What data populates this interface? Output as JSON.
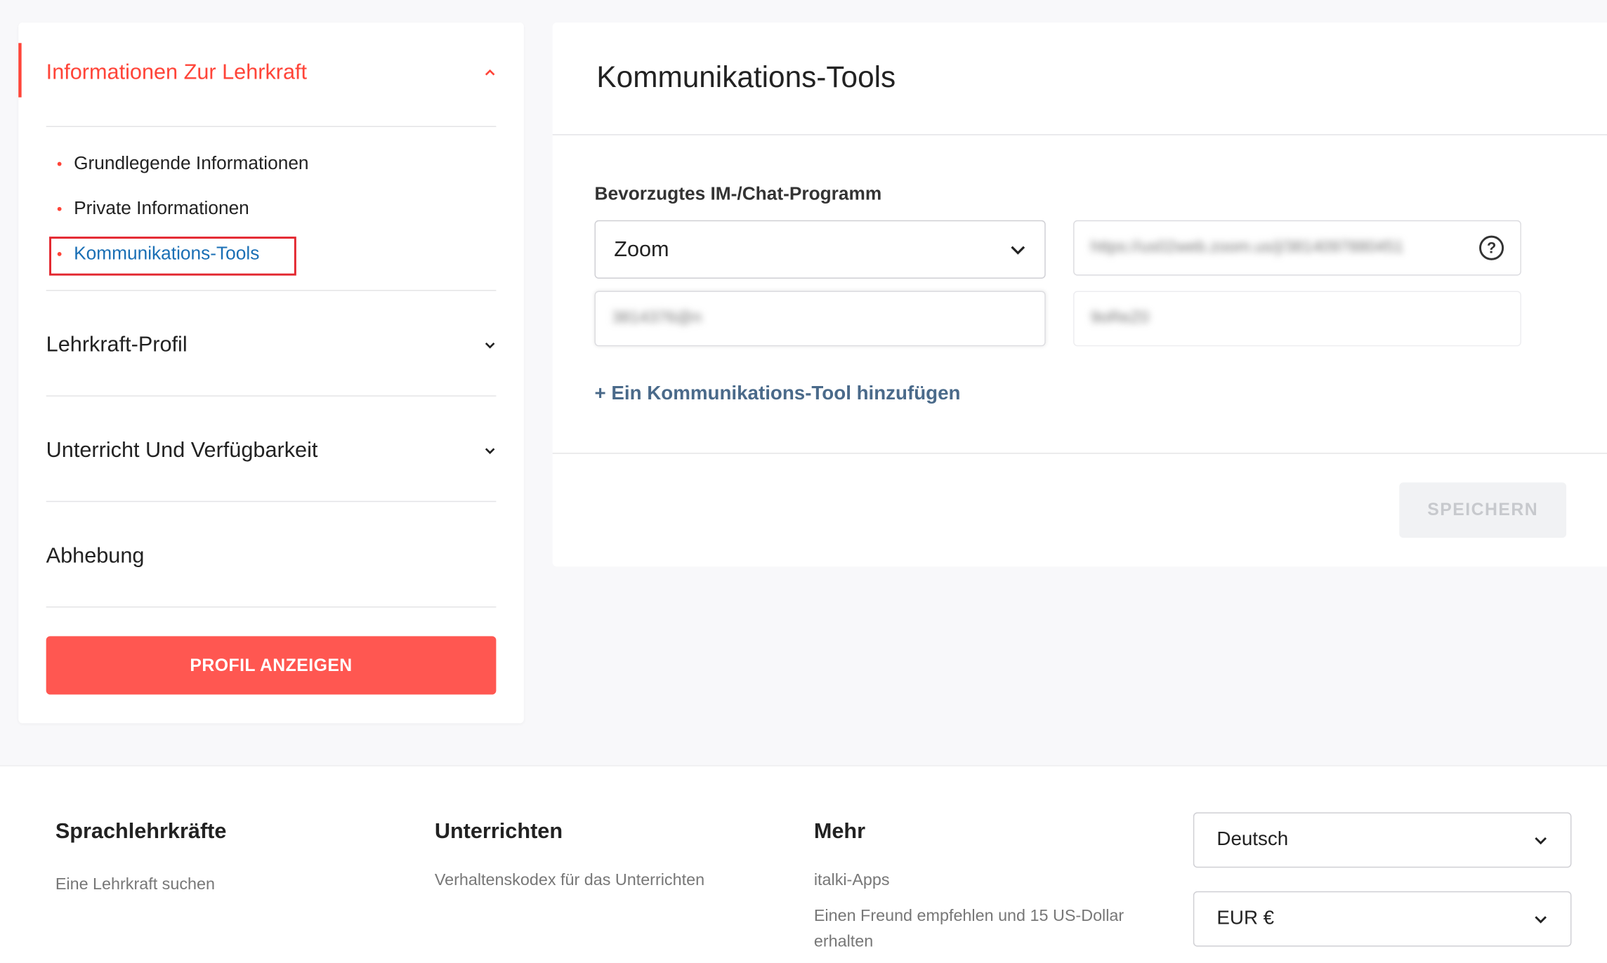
{
  "sidebar": {
    "section_teacher_info": "Informationen Zur Lehrkraft",
    "sub_items": [
      "Grundlegende Informationen",
      "Private Informationen",
      "Kommunikations-Tools"
    ],
    "section_profile": "Lehrkraft-Profil",
    "section_teaching": "Unterricht Und Verfügbarkeit",
    "section_withdrawal": "Abhebung",
    "profile_button": "PROFIL ANZEIGEN"
  },
  "main": {
    "title": "Kommunikations-Tools",
    "field_label": "Bevorzugtes IM-/Chat-Programm",
    "program_selected": "Zoom",
    "meeting_link_blurred": "https://us02web.zoom.us/j/3814097880451",
    "meeting_id_blurred": "3814376@n",
    "passcode_blurred": "9oReZ0",
    "help_symbol": "?",
    "add_tool_link": "+ Ein Kommunikations-Tool hinzufügen",
    "save_button": "SPEICHERN"
  },
  "footer": {
    "col1_title": "Sprachlehrkräfte",
    "col1_link1": "Eine Lehrkraft suchen",
    "col2_title": "Unterrichten",
    "col2_link1": "Verhaltenskodex für das Unterrichten",
    "col3_title": "Mehr",
    "col3_link1": "italki-Apps",
    "col3_link2": "Einen Freund empfehlen und 15 US-Dollar erhalten",
    "language_selected": "Deutsch",
    "currency_selected": "EUR €"
  },
  "colors": {
    "accent": "#ff4438",
    "button_red": "#ff5751",
    "link_blue": "#1a6fb5",
    "highlight_box": "#e3262e"
  }
}
